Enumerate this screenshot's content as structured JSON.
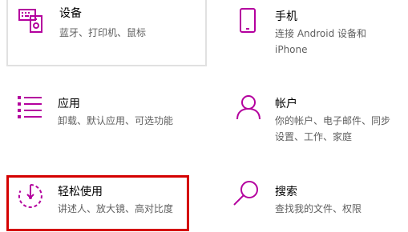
{
  "accent_color": "#b4009e",
  "highlight_border_color": "#d40000",
  "tiles": [
    {
      "id": "devices",
      "icon": "keyboard-speaker-icon",
      "title": "设备",
      "description": [
        "蓝牙、打印机、鼠标"
      ]
    },
    {
      "id": "phone",
      "icon": "phone-icon",
      "title": "手机",
      "description": [
        "连接 Android 设备和",
        "iPhone"
      ]
    },
    {
      "id": "apps",
      "icon": "apps-list-icon",
      "title": "应用",
      "description": [
        "卸载、默认应用、可选功能"
      ]
    },
    {
      "id": "accounts",
      "icon": "person-icon",
      "title": "帐户",
      "description": [
        "你的帐户、电子邮件、同步",
        "设置、工作、家庭"
      ]
    },
    {
      "id": "ease-of-access",
      "icon": "ease-of-access-icon",
      "title": "轻松使用",
      "description": [
        "讲述人、放大镜、高对比度"
      ]
    },
    {
      "id": "search",
      "icon": "search-icon",
      "title": "搜索",
      "description": [
        "查找我的文件、权限"
      ]
    }
  ]
}
